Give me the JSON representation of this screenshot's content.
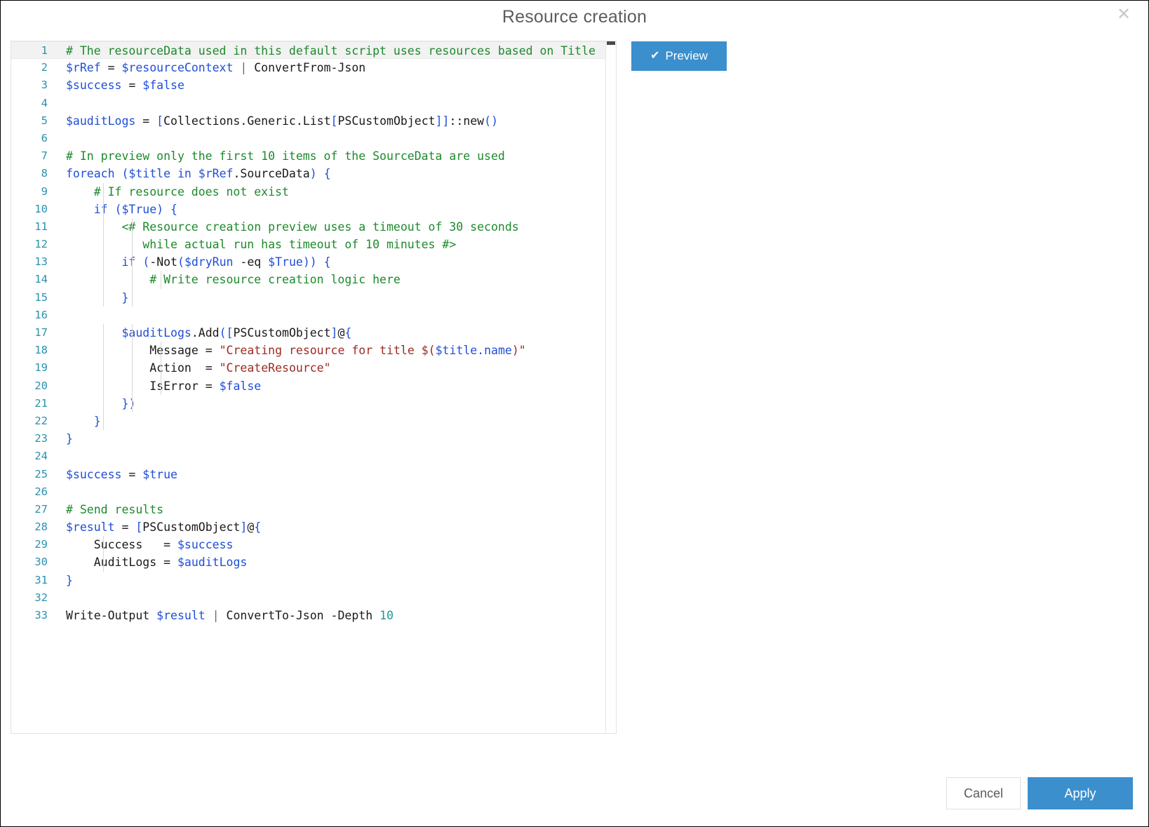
{
  "dialog": {
    "title": "Resource creation",
    "close_icon": "close-icon",
    "close_glyph": "✕"
  },
  "toolbar": {
    "preview_label": "Preview",
    "preview_icon": "checkmark-icon",
    "preview_glyph": "✔"
  },
  "footer": {
    "cancel_label": "Cancel",
    "apply_label": "Apply"
  },
  "colors": {
    "accent": "#3b8fcd",
    "comment": "#1d8a2c",
    "variable": "#1f4ed8",
    "string": "#9c2a21",
    "number": "#1a9a9a",
    "line_number": "#2b91af",
    "current_line_bg": "#f2f2f2"
  },
  "editor": {
    "language": "powershell",
    "total_lines": 33,
    "current_line": 1,
    "scrollbar": {
      "orientation": "vertical",
      "thumb_position": "top"
    },
    "lines": [
      {
        "n": "1",
        "text": "# The resourceData used in this default script uses resources based on Title"
      },
      {
        "n": "2",
        "text": "$rRef = $resourceContext | ConvertFrom-Json"
      },
      {
        "n": "3",
        "text": "$success = $false"
      },
      {
        "n": "4",
        "text": ""
      },
      {
        "n": "5",
        "text": "$auditLogs = [Collections.Generic.List[PSCustomObject]]::new()"
      },
      {
        "n": "6",
        "text": ""
      },
      {
        "n": "7",
        "text": "# In preview only the first 10 items of the SourceData are used"
      },
      {
        "n": "8",
        "text": "foreach ($title in $rRef.SourceData) {"
      },
      {
        "n": "9",
        "text": "    # If resource does not exist"
      },
      {
        "n": "10",
        "text": "    if ($True) {"
      },
      {
        "n": "11",
        "text": "        <# Resource creation preview uses a timeout of 30 seconds"
      },
      {
        "n": "12",
        "text": "           while actual run has timeout of 10 minutes #>"
      },
      {
        "n": "13",
        "text": "        if (-Not($dryRun -eq $True)) {"
      },
      {
        "n": "14",
        "text": "            # Write resource creation logic here"
      },
      {
        "n": "15",
        "text": "        }"
      },
      {
        "n": "16",
        "text": ""
      },
      {
        "n": "17",
        "text": "        $auditLogs.Add([PSCustomObject]@{"
      },
      {
        "n": "18",
        "text": "            Message = \"Creating resource for title $($title.name)\""
      },
      {
        "n": "19",
        "text": "            Action  = \"CreateResource\""
      },
      {
        "n": "20",
        "text": "            IsError = $false"
      },
      {
        "n": "21",
        "text": "        })"
      },
      {
        "n": "22",
        "text": "    }"
      },
      {
        "n": "23",
        "text": "}"
      },
      {
        "n": "24",
        "text": ""
      },
      {
        "n": "25",
        "text": "$success = $true"
      },
      {
        "n": "26",
        "text": ""
      },
      {
        "n": "27",
        "text": "# Send results"
      },
      {
        "n": "28",
        "text": "$result = [PSCustomObject]@{"
      },
      {
        "n": "29",
        "text": "    Success   = $success"
      },
      {
        "n": "30",
        "text": "    AuditLogs = $auditLogs"
      },
      {
        "n": "31",
        "text": "}"
      },
      {
        "n": "32",
        "text": ""
      },
      {
        "n": "33",
        "text": "Write-Output $result | ConvertTo-Json -Depth 10"
      }
    ]
  }
}
